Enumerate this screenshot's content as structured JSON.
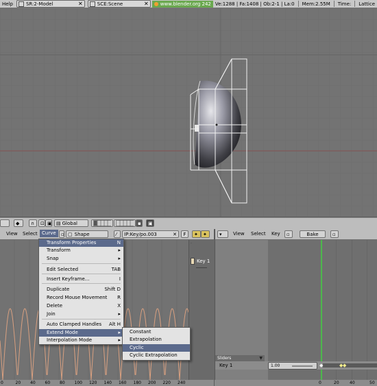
{
  "topbar": {
    "help": "Help",
    "screen": "SR:2-Model",
    "scene": "SCE:Scene",
    "url": "www.blender.org 242",
    "stats": "Ve:1288 | Fa:1408 | Ob:2-1 | La:0",
    "mem": "Mem:2.55M",
    "time": "Time:",
    "object": "Lattice"
  },
  "view3d_header": {
    "orientation": "Global"
  },
  "ipo_header": {
    "view": "View",
    "select": "Select",
    "curve": "Curve",
    "type": "Shape",
    "ipo_name": "IP:Key/po.003",
    "f_label": "F"
  },
  "ipo_channels": {
    "key": "Key 1"
  },
  "ipo_ruler": [
    "0",
    "20",
    "40",
    "60",
    "80",
    "100",
    "120",
    "140",
    "160",
    "180",
    "200",
    "220",
    "240"
  ],
  "action_header": {
    "view": "View",
    "select": "Select",
    "key": "Key",
    "bake": "Bake"
  },
  "action_panel": {
    "sliders": "Sliders",
    "key_name": "Key 1",
    "key_value": "1.00"
  },
  "action_ruler": [
    "0",
    "20",
    "40",
    "50"
  ],
  "curve_menu": {
    "title": "Transform Properties",
    "title_shortcut": "N",
    "items": [
      {
        "label": "Transform",
        "shortcut": "▸"
      },
      {
        "label": "Snap",
        "shortcut": "▸"
      },
      {
        "label": "Edit Selected",
        "shortcut": "TAB"
      },
      {
        "label": "Insert Keyframe...",
        "shortcut": "I"
      },
      {
        "label": "Duplicate",
        "shortcut": "Shift D"
      },
      {
        "label": "Record Mouse Movement",
        "shortcut": "R"
      },
      {
        "label": "Delete",
        "shortcut": "X"
      },
      {
        "label": "Join",
        "shortcut": "▸"
      },
      {
        "label": "Auto Clamped Handles",
        "shortcut": "Alt H"
      },
      {
        "label": "Extend Mode",
        "shortcut": "▸"
      },
      {
        "label": "Interpolation Mode",
        "shortcut": "▸"
      }
    ]
  },
  "extend_submenu": {
    "items": [
      "Constant",
      "Extrapolation",
      "Cyclic",
      "Cyclic Extrapolation"
    ]
  },
  "colors": {
    "menu_highlight": "#5b6a8c",
    "frame_line": "#4cb84c",
    "curve_color": "#d9a080",
    "url_badge": "#6aa84f"
  }
}
